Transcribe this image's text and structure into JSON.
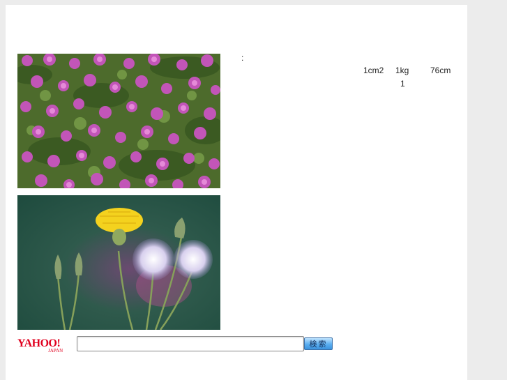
{
  "content": {
    "colon": ":",
    "units": [
      "1cm2",
      "1kg",
      "76cm"
    ],
    "unit_number": "1"
  },
  "images": {
    "top": "pink-oxalis-flowers-photo",
    "bottom": "yellow-flower-and-dandelion-seedheads-photo"
  },
  "search": {
    "logo_text": "YAHOO!",
    "logo_subtext": "JAPAN",
    "input_value": "",
    "input_placeholder": "",
    "button_label": "検索"
  },
  "colors": {
    "page_bg": "#ffffff",
    "outer_bg": "#ececec",
    "yahoo_red": "#e0001e",
    "button_blue": "#5aaef0"
  }
}
